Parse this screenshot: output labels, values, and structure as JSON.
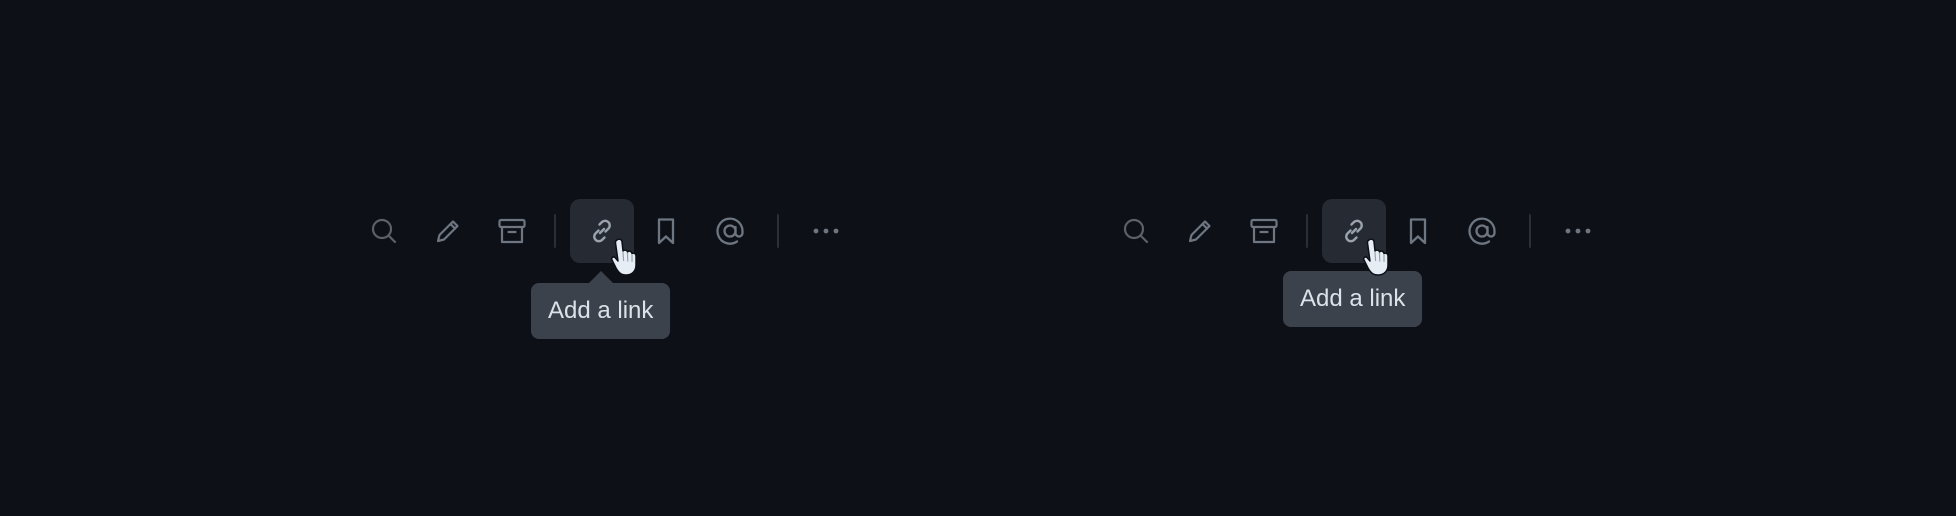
{
  "variants": [
    {
      "toolbar": {
        "buttons": [
          {
            "icon": "search-icon"
          },
          {
            "icon": "pencil-icon"
          },
          {
            "icon": "archive-icon"
          },
          {
            "icon": "link-icon",
            "state": "hovered"
          },
          {
            "icon": "bookmark-icon"
          },
          {
            "icon": "at-sign-icon"
          },
          {
            "icon": "more-horizontal-icon"
          }
        ]
      },
      "tooltip": {
        "text": "Add a link",
        "has_arrow": true
      }
    },
    {
      "toolbar": {
        "buttons": [
          {
            "icon": "search-icon"
          },
          {
            "icon": "pencil-icon"
          },
          {
            "icon": "archive-icon"
          },
          {
            "icon": "link-icon",
            "state": "hovered"
          },
          {
            "icon": "bookmark-icon"
          },
          {
            "icon": "at-sign-icon"
          },
          {
            "icon": "more-horizontal-icon"
          }
        ]
      },
      "tooltip": {
        "text": "Add a link",
        "has_arrow": false
      }
    }
  ],
  "colors": {
    "background": "#0d1017",
    "icon": "#6e7681",
    "active_bg": "#262a33",
    "tooltip_bg": "#3c424c",
    "tooltip_text": "#dde2e8",
    "cursor": "#e6edf5"
  }
}
